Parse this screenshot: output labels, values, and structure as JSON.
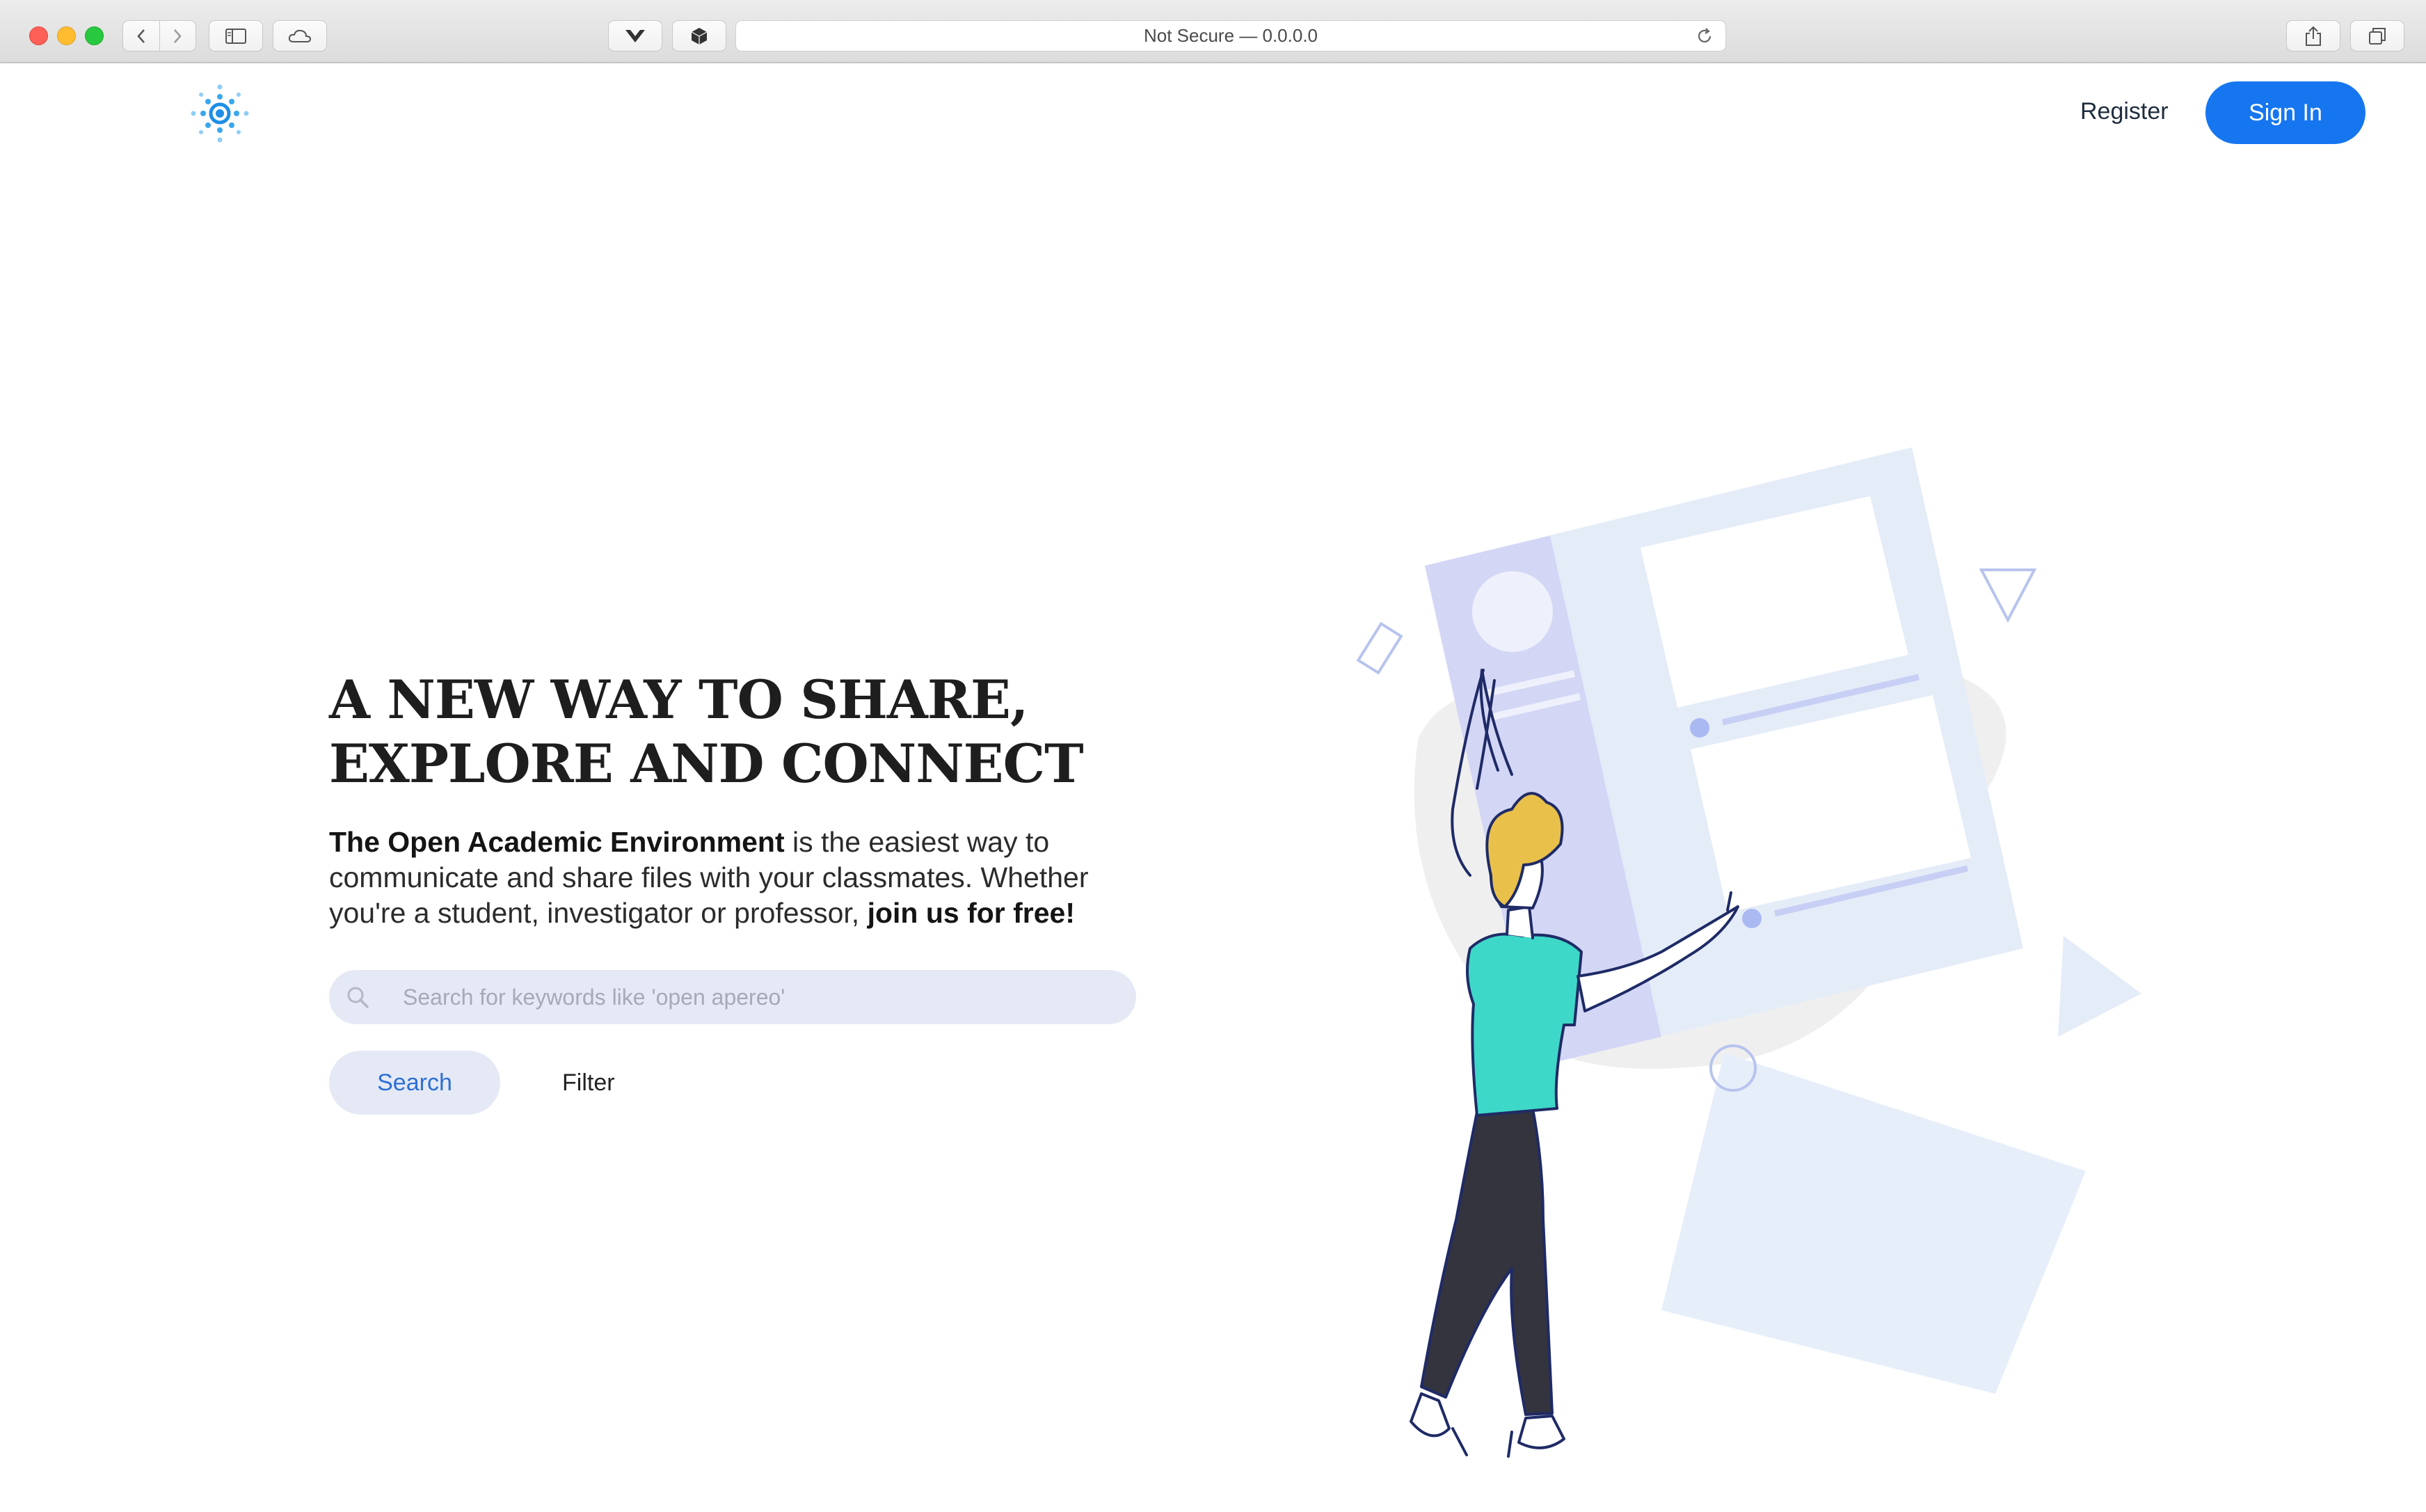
{
  "browser": {
    "address_text": "Not Secure — 0.0.0.0"
  },
  "nav": {
    "register_label": "Register",
    "signin_label": "Sign In"
  },
  "hero": {
    "headline_line1": "A NEW WAY TO SHARE,",
    "headline_line2": "EXPLORE AND CONNECT",
    "intro_brand": "The Open Academic Environment",
    "intro_text": " is the easiest way to communicate and share files with your classmates. Whether you're a student, investigator or professor, ",
    "intro_cta": "join us for free!"
  },
  "search": {
    "placeholder": "Search for keywords like 'open apereo'",
    "search_label": "Search",
    "filter_label": "Filter"
  },
  "colors": {
    "primary": "#1676f0",
    "search_bg": "#e5e9f5",
    "illustration_panel": "#e4ecf8",
    "illustration_sidebar": "#d3d6f5",
    "shirt": "#3ed8c8",
    "hair": "#e9c04a"
  },
  "icons": {
    "logo": "oae-logo-icon",
    "search": "search-icon"
  }
}
